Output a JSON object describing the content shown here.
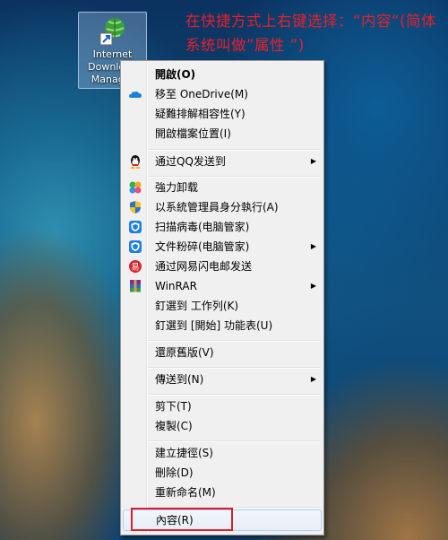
{
  "annotation": "在快捷方式上右键选择：“内容“(简体系统叫做”属性 ”)",
  "desktop_icon": {
    "label": "Internet\nDownload\nManag..."
  },
  "menu": {
    "items": [
      {
        "label": "開啟(O)",
        "bold": true
      },
      {
        "label": "移至 OneDrive(M)",
        "icon": "onedrive-icon"
      },
      {
        "label": "疑難排解相容性(Y)"
      },
      {
        "label": "開啟檔案位置(I)"
      },
      {
        "label": "通过QQ发送到",
        "icon": "qq-icon",
        "submenu": true
      },
      {
        "label": "強力卸载",
        "icon": "uninstall-icon"
      },
      {
        "label": "以系統管理員身分執行(A)",
        "icon": "uac-shield-icon"
      },
      {
        "label": "扫描病毒(电脑管家)",
        "icon": "pc-manager-icon"
      },
      {
        "label": "文件粉碎(电脑管家)",
        "icon": "pc-manager-icon",
        "submenu": true
      },
      {
        "label": "通过网易闪电邮发送",
        "icon": "netease-mail-icon"
      },
      {
        "label": "WinRAR",
        "icon": "winrar-icon",
        "submenu": true
      },
      {
        "label": "釘選到 工作列(K)"
      },
      {
        "label": "釘選到 [開始] 功能表(U)"
      },
      {
        "label": "還原舊版(V)"
      },
      {
        "label": "傳送到(N)",
        "submenu": true
      },
      {
        "label": "剪下(T)"
      },
      {
        "label": "複製(C)"
      },
      {
        "label": "建立捷徑(S)"
      },
      {
        "label": "刪除(D)"
      },
      {
        "label": "重新命名(M)"
      },
      {
        "label": "內容(R)"
      }
    ],
    "submenu_arrow": "▶"
  },
  "colors": {
    "annotation": "#e8202a",
    "highlight_border": "#d8202a",
    "menu_bg": "#f0f0f0"
  }
}
